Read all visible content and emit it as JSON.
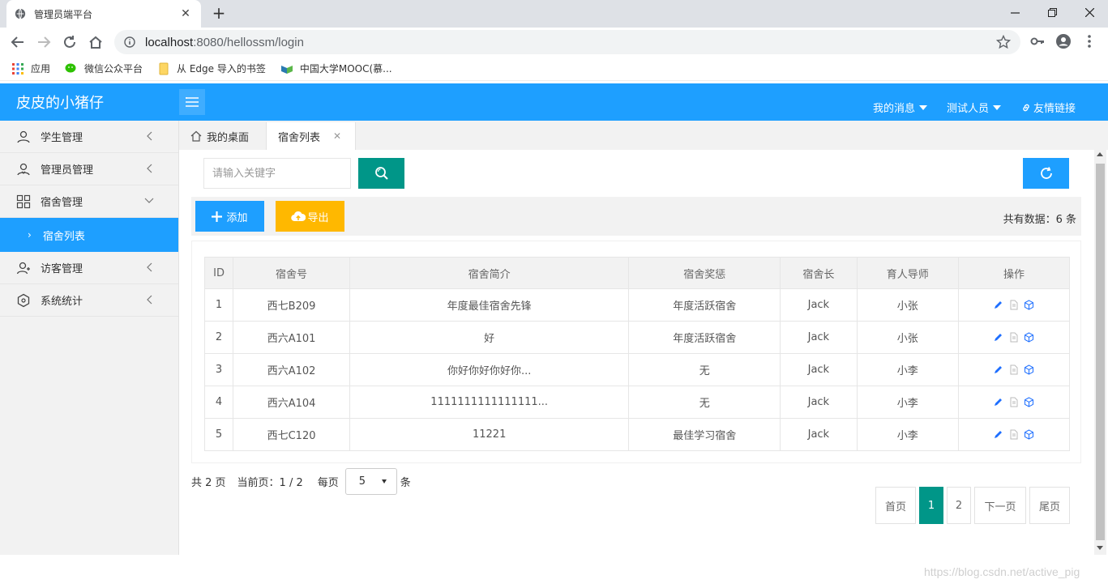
{
  "browser": {
    "tab_title": "管理员端平台",
    "url_host": "localhost",
    "url_path": ":8080/hellossm/login",
    "bookmarks": [
      {
        "label": "应用",
        "icon": "apps-grid-icon"
      },
      {
        "label": "微信公众平台",
        "icon": "wechat-icon"
      },
      {
        "label": "从 Edge 导入的书签",
        "icon": "folder-icon"
      },
      {
        "label": "中国大学MOOC(慕...",
        "icon": "mooc-icon"
      }
    ]
  },
  "header": {
    "logo": "皮皮的小猪仔",
    "messages": "我的消息",
    "user": "测试人员",
    "links": "友情链接"
  },
  "sidebar": {
    "items": [
      {
        "label": "学生管理",
        "icon": "user-icon"
      },
      {
        "label": "管理员管理",
        "icon": "admin-icon"
      },
      {
        "label": "宿舍管理",
        "icon": "grid-icon"
      },
      {
        "label": "宿舍列表",
        "icon": "chevron-right-icon"
      },
      {
        "label": "访客管理",
        "icon": "visitor-icon"
      },
      {
        "label": "系统统计",
        "icon": "stats-icon"
      }
    ]
  },
  "main": {
    "tabs": [
      {
        "label": "我的桌面"
      },
      {
        "label": "宿舍列表"
      }
    ],
    "search_placeholder": "请输入关键字",
    "add_label": "添加",
    "export_label": "导出",
    "total": "共有数据：6 条",
    "columns": [
      "ID",
      "宿舍号",
      "宿舍简介",
      "宿舍奖惩",
      "宿舍长",
      "育人导师",
      "操作"
    ],
    "rows": [
      [
        "1",
        "西七B209",
        "年度最佳宿舍先锋",
        "年度活跃宿舍",
        "Jack",
        "小张"
      ],
      [
        "2",
        "西六A101",
        "好",
        "年度活跃宿舍",
        "Jack",
        "小张"
      ],
      [
        "3",
        "西六A102",
        "你好你好你好你...",
        "无",
        "Jack",
        "小李"
      ],
      [
        "4",
        "西六A104",
        "1111111111111111...",
        "无",
        "Jack",
        "小李"
      ],
      [
        "5",
        "西七C120",
        "11221",
        "最佳学习宿舍",
        "Jack",
        "小李"
      ]
    ],
    "page_info": {
      "total_pages": "共 2 页",
      "current": "当前页：1 / 2",
      "per_page_label": "每页",
      "per_page": "5",
      "unit": "条"
    },
    "pager": {
      "first": "首页",
      "page1": "1",
      "page2": "2",
      "next": "下一页",
      "last": "尾页"
    }
  },
  "watermark": "https://blog.csdn.net/active_pig",
  "colors": {
    "primary": "#1e9fff",
    "teal": "#009688",
    "warn": "#ffb800"
  }
}
